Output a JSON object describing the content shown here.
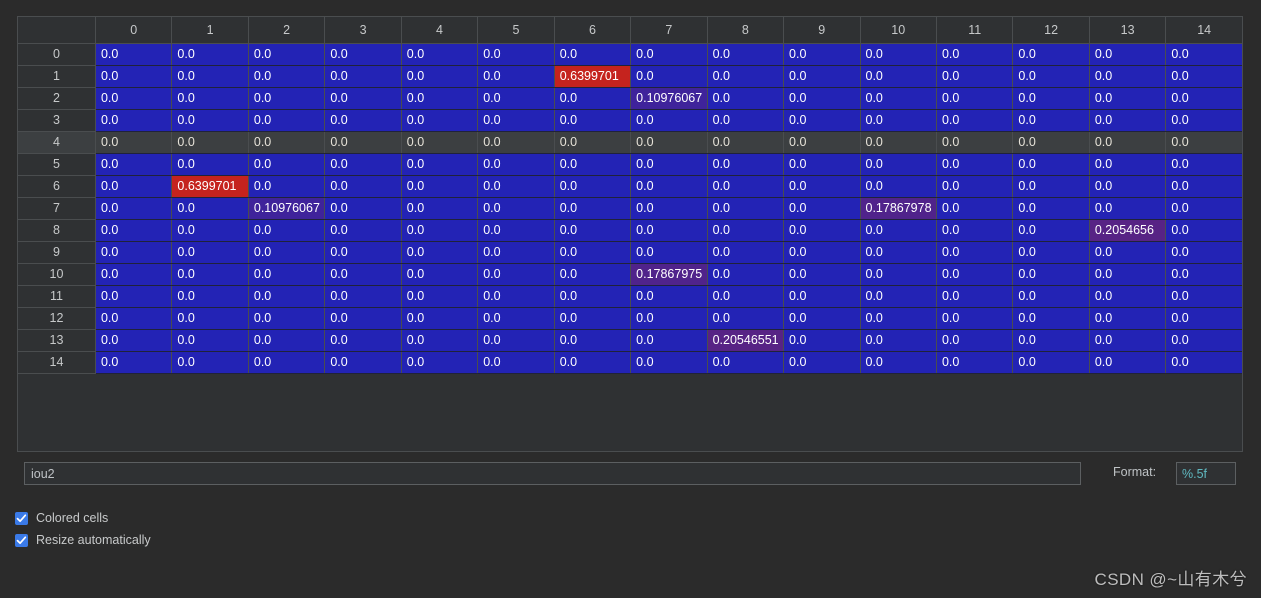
{
  "window": {
    "background": "#2b2b2b"
  },
  "table": {
    "corner_label": "",
    "column_headers": [
      "0",
      "1",
      "2",
      "3",
      "4",
      "5",
      "6",
      "7",
      "8",
      "9",
      "10",
      "11",
      "12",
      "13",
      "14"
    ],
    "row_headers": [
      "0",
      "1",
      "2",
      "3",
      "4",
      "5",
      "6",
      "7",
      "8",
      "9",
      "10",
      "11",
      "12",
      "13",
      "14"
    ],
    "selected_row_index": 4,
    "zero_text": "0.0",
    "colors": {
      "zero_cell": "#2323b5",
      "selected_row": "#3c3f41",
      "header_bg": "#2f3133",
      "grid_line": "#4a4d4f",
      "max_value": "#c5231e",
      "text": "#ffffff"
    },
    "rows": [
      [
        "0.0",
        "0.0",
        "0.0",
        "0.0",
        "0.0",
        "0.0",
        "0.0",
        "0.0",
        "0.0",
        "0.0",
        "0.0",
        "0.0",
        "0.0",
        "0.0",
        "0.0"
      ],
      [
        "0.0",
        "0.0",
        "0.0",
        "0.0",
        "0.0",
        "0.0",
        "0.6399701",
        "0.0",
        "0.0",
        "0.0",
        "0.0",
        "0.0",
        "0.0",
        "0.0",
        "0.0"
      ],
      [
        "0.0",
        "0.0",
        "0.0",
        "0.0",
        "0.0",
        "0.0",
        "0.0",
        "0.10976067",
        "0.0",
        "0.0",
        "0.0",
        "0.0",
        "0.0",
        "0.0",
        "0.0"
      ],
      [
        "0.0",
        "0.0",
        "0.0",
        "0.0",
        "0.0",
        "0.0",
        "0.0",
        "0.0",
        "0.0",
        "0.0",
        "0.0",
        "0.0",
        "0.0",
        "0.0",
        "0.0"
      ],
      [
        "0.0",
        "0.0",
        "0.0",
        "0.0",
        "0.0",
        "0.0",
        "0.0",
        "0.0",
        "0.0",
        "0.0",
        "0.0",
        "0.0",
        "0.0",
        "0.0",
        "0.0"
      ],
      [
        "0.0",
        "0.0",
        "0.0",
        "0.0",
        "0.0",
        "0.0",
        "0.0",
        "0.0",
        "0.0",
        "0.0",
        "0.0",
        "0.0",
        "0.0",
        "0.0",
        "0.0"
      ],
      [
        "0.0",
        "0.6399701",
        "0.0",
        "0.0",
        "0.0",
        "0.0",
        "0.0",
        "0.0",
        "0.0",
        "0.0",
        "0.0",
        "0.0",
        "0.0",
        "0.0",
        "0.0"
      ],
      [
        "0.0",
        "0.0",
        "0.10976067",
        "0.0",
        "0.0",
        "0.0",
        "0.0",
        "0.0",
        "0.0",
        "0.0",
        "0.17867978",
        "0.0",
        "0.0",
        "0.0",
        "0.0"
      ],
      [
        "0.0",
        "0.0",
        "0.0",
        "0.0",
        "0.0",
        "0.0",
        "0.0",
        "0.0",
        "0.0",
        "0.0",
        "0.0",
        "0.0",
        "0.0",
        "0.2054656",
        "0.0"
      ],
      [
        "0.0",
        "0.0",
        "0.0",
        "0.0",
        "0.0",
        "0.0",
        "0.0",
        "0.0",
        "0.0",
        "0.0",
        "0.0",
        "0.0",
        "0.0",
        "0.0",
        "0.0"
      ],
      [
        "0.0",
        "0.0",
        "0.0",
        "0.0",
        "0.0",
        "0.0",
        "0.0",
        "0.17867975",
        "0.0",
        "0.0",
        "0.0",
        "0.0",
        "0.0",
        "0.0",
        "0.0"
      ],
      [
        "0.0",
        "0.0",
        "0.0",
        "0.0",
        "0.0",
        "0.0",
        "0.0",
        "0.0",
        "0.0",
        "0.0",
        "0.0",
        "0.0",
        "0.0",
        "0.0",
        "0.0"
      ],
      [
        "0.0",
        "0.0",
        "0.0",
        "0.0",
        "0.0",
        "0.0",
        "0.0",
        "0.0",
        "0.0",
        "0.0",
        "0.0",
        "0.0",
        "0.0",
        "0.0",
        "0.0"
      ],
      [
        "0.0",
        "0.0",
        "0.0",
        "0.0",
        "0.0",
        "0.0",
        "0.0",
        "0.0",
        "0.20546551",
        "0.0",
        "0.0",
        "0.0",
        "0.0",
        "0.0",
        "0.0"
      ],
      [
        "0.0",
        "0.0",
        "0.0",
        "0.0",
        "0.0",
        "0.0",
        "0.0",
        "0.0",
        "0.0",
        "0.0",
        "0.0",
        "0.0",
        "0.0",
        "0.0",
        "0.0"
      ]
    ]
  },
  "controls": {
    "name_value": "iou2",
    "name_placeholder": "",
    "format_label": "Format:",
    "format_value": "%.5f",
    "checkboxes": [
      {
        "label": "Colored cells",
        "checked": true
      },
      {
        "label": "Resize automatically",
        "checked": true
      }
    ]
  },
  "watermark": {
    "text": "CSDN @~山有木兮"
  }
}
